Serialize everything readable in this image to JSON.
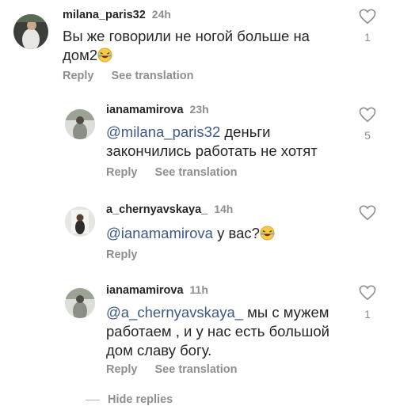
{
  "comments": [
    {
      "username": "milana_paris32",
      "time": "24h",
      "mention": "",
      "text_line1": "Вы же говорили не ногой больше на",
      "text_line2": "дом2",
      "likes": "1",
      "actions": [
        "Reply",
        "See translation"
      ]
    },
    {
      "username": "ianamamirova",
      "time": "23h",
      "mention": "@milana_paris32",
      "text_line1": " деньги",
      "text_line2": "закончились работать не хотят",
      "likes": "5",
      "actions": [
        "Reply",
        "See translation"
      ]
    },
    {
      "username": "a_chernyavskaya_",
      "time": "14h",
      "mention": "@ianamamirova",
      "text_line1": " у вас?",
      "likes": "",
      "actions": [
        "Reply"
      ]
    },
    {
      "username": "ianamamirova",
      "time": "11h",
      "mention": "@a_chernyavskaya_",
      "text_line1": " мы с мужем",
      "text_line2": "работаем , и у нас есть большой",
      "text_line3": "дом славу богу.",
      "likes": "1",
      "actions": [
        "Reply",
        "See translation"
      ]
    }
  ],
  "hide_replies": "Hide replies",
  "colors": {
    "mention": "#3b5a86",
    "muted": "#8e8e8e",
    "text": "#262626"
  }
}
